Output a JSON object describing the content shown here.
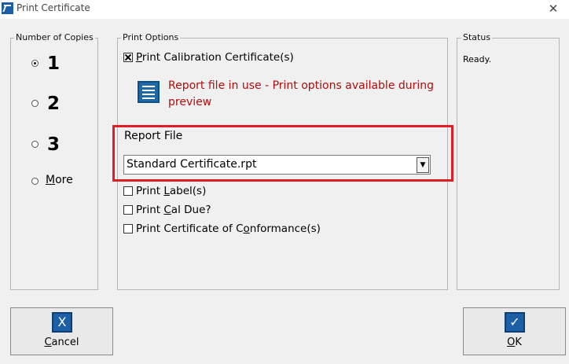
{
  "window": {
    "title": "Print Certificate",
    "close_glyph": "✕"
  },
  "copies": {
    "legend": "Number of Copies",
    "options": [
      {
        "label": "1",
        "selected": true
      },
      {
        "label": "2",
        "selected": false
      },
      {
        "label": "3",
        "selected": false
      },
      {
        "label": "More",
        "selected": false,
        "mnemonic": "M",
        "rest": "ore"
      }
    ]
  },
  "print_options": {
    "legend": "Print Options",
    "calibration": {
      "checked": true,
      "mnemonic": "P",
      "rest": "rint Calibration Certificate(s)"
    },
    "warning_line1": "Report file in use - Print options available during",
    "warning_line2": "preview",
    "report_file_label": "Report File",
    "report_file_value": "Standard Certificate.rpt",
    "label_opt": {
      "checked": false,
      "pre": "Print ",
      "mnemonic": "L",
      "rest": "abel(s)"
    },
    "cal_due_opt": {
      "checked": false,
      "pre": "Print ",
      "mnemonic": "C",
      "rest": "al Due?"
    },
    "conformance_opt": {
      "checked": false,
      "pre": "Print Certificate of C",
      "mnemonic": "o",
      "rest": "nformance(s)"
    }
  },
  "status": {
    "legend": "Status",
    "text": "Ready."
  },
  "buttons": {
    "cancel": {
      "mnemonic": "C",
      "rest": "ancel",
      "icon_glyph": "X"
    },
    "ok": {
      "mnemonic": "O",
      "rest": "K",
      "icon_glyph": "✓"
    }
  },
  "colors": {
    "highlight_outline": "#e01c24",
    "warning_text": "#b10c0c",
    "icon_blue": "#1d5fa5"
  }
}
